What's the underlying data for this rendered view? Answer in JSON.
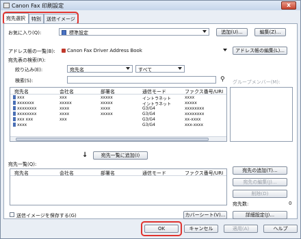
{
  "window": {
    "title": "Canon Fax 印刷設定",
    "close_glyph": "x"
  },
  "tabs": [
    {
      "label": "宛先選択",
      "active": true
    },
    {
      "label": "特別",
      "active": false
    },
    {
      "label": "送信イメージ",
      "active": false
    }
  ],
  "favorites": {
    "label": "お気に入り(Q):",
    "value": "標準設定",
    "add_button": "追加(U)...",
    "edit_button": "編集(Z)..."
  },
  "address_book": {
    "label": "アドレス帳の一覧(B):",
    "value": "Canon Fax Driver Address Book",
    "edit_button": "アドレス帳の編集(L)..."
  },
  "search": {
    "section_label": "宛先表の検索(R):",
    "filter_label": "絞り込み(E):",
    "filter_field": "宛先名",
    "filter_value": "すべて",
    "search_label": "検索(S):",
    "search_value": "",
    "group_members_label": "グループメンバー(M):"
  },
  "address_list": {
    "columns": [
      "宛先名",
      "会社名",
      "部署名",
      "通信モード",
      "ファクス番号/URI"
    ],
    "rows": [
      [
        "xxx",
        "xxx",
        "xxxxx",
        "イントラネット",
        "xxxx"
      ],
      [
        "xxxxxxx",
        "xxxxx",
        "xxxxx",
        "イントラネット",
        "xxxxx"
      ],
      [
        "xxxxxxxx",
        "xxxx",
        "xxxx",
        "G3/G4",
        "xxxxxxxx"
      ],
      [
        "xxxxxxxx",
        "xxxx",
        "xxxxx",
        "G3/G4",
        "xxxxxxxx"
      ],
      [
        "xxx xxx",
        "xxx",
        "",
        "G3/G4",
        "xx-xxxx"
      ],
      [
        "xxxx",
        "",
        "",
        "G3/G4",
        "xxx-xxxx"
      ]
    ]
  },
  "add_to_list_button": "宛先一覧に追加(I)",
  "recipient_list": {
    "label": "宛先一覧(Q):",
    "columns": [
      "宛先名",
      "会社名",
      "部署名",
      "通信モード",
      "ファクス番号/URI"
    ],
    "add_button": "宛先の追加(T)...",
    "edit_button": "宛先の編集(J)...",
    "delete_button": "削除(D)",
    "count_label": "宛先数:",
    "count_value": "0"
  },
  "footer": {
    "save_image_label": "送信イメージを保存する(G)",
    "cover_sheet_button": "カバーシート(V)...",
    "detail_button": "詳細設定(J)...",
    "ok_button": "OK",
    "cancel_button": "キャンセル",
    "apply_button": "適用(A)",
    "help_button": "ヘルプ"
  },
  "colors": {
    "accent_ring": "#e0332e",
    "window_bg": "#e9eef5"
  }
}
